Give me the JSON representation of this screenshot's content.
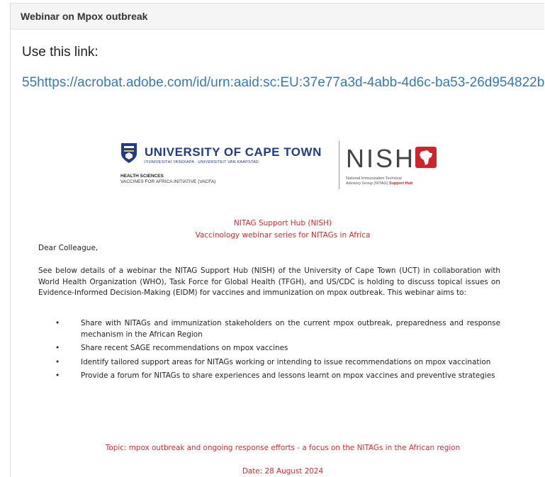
{
  "panel": {
    "title": "Webinar on Mpox outbreak"
  },
  "message": {
    "lead": "Use this link:",
    "link": "55https://acrobat.adobe.com/id/urn:aaid:sc:EU:37e77a3d-4abb-4d6c-ba53-26d954822b"
  },
  "letter": {
    "logos": {
      "uct_name": "UNIVERSITY OF CAPE TOWN",
      "uct_subtitle": "IYUNIVESITHI YASEKAPA · UNIVERSITEIT VAN KAAPSTAD",
      "uct_faculty": "HEALTH SCIENCES",
      "uct_initiative": "VACCINES FOR AFRICA INITIATIVE (VACFA)",
      "nish_word": "NISH",
      "nish_line1": "National Immunization Technical",
      "nish_line2_prefix": "Advisory Group (NITAG)",
      "nish_line2_highlight": "Support Hub"
    },
    "heading_line1": "NITAG Support Hub (NISH)",
    "heading_line2": "Vaccinology webinar series for NITAGs in Africa",
    "salutation": "Dear Colleague,",
    "paragraph": "See below details of a webinar the NITAG Support Hub (NISH) of the University of Cape Town (UCT) in collaboration with World Health Organization (WHO), Task Force for Global Health (TFGH), and US/CDC is holding to discuss topical issues on Evidence-Informed Decision-Making (EIDM) for vaccines and immunization on mpox outbreak. This webinar aims to:",
    "bullets": [
      "Share with NITAGs and immunization stakeholders on the current mpox outbreak, preparedness and response mechanism in the African Region",
      "Share recent SAGE recommendations on mpox vaccines",
      "Identify tailored support areas for NITAGs working or intending to issue recommendations on mpox vaccination",
      "Provide a forum for NITAGs to share experiences and lessons learnt on mpox vaccines and preventive strategies"
    ],
    "topic": "Topic: mpox outbreak and ongoing response efforts - a focus on the NITAGs in the African region",
    "date": "Date: 28 August 2024"
  },
  "colors": {
    "link": "#337ab7",
    "accent_red": "#e0262b",
    "uct_blue": "#1f3b8a"
  }
}
